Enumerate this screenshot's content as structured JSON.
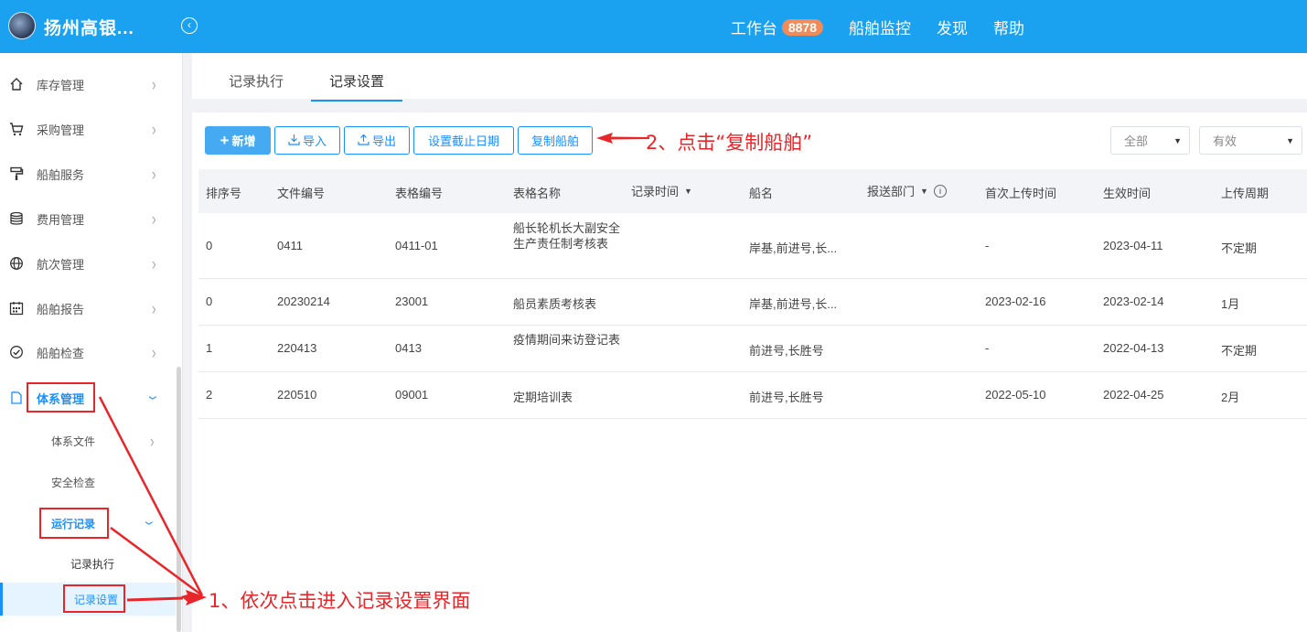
{
  "header": {
    "app_title": "扬州高银...",
    "nav": [
      {
        "label": "工作台",
        "badge": "8878"
      },
      {
        "label": "船舶监控"
      },
      {
        "label": "发现"
      },
      {
        "label": "帮助"
      }
    ]
  },
  "sidebar": {
    "items": [
      {
        "label": "库存管理",
        "icon": "home-icon"
      },
      {
        "label": "采购管理",
        "icon": "cart-icon"
      },
      {
        "label": "船舶服务",
        "icon": "paint-roller-icon"
      },
      {
        "label": "费用管理",
        "icon": "database-icon"
      },
      {
        "label": "航次管理",
        "icon": "globe-icon"
      },
      {
        "label": "船舶报告",
        "icon": "calendar-icon"
      },
      {
        "label": "船舶检查",
        "icon": "check-circle-icon"
      },
      {
        "label": "体系管理",
        "icon": "file-icon"
      }
    ],
    "sub_items": {
      "system_files": "体系文件",
      "safety_check": "安全检查",
      "operation_records": "运行记录",
      "record_execution": "记录执行",
      "record_settings": "记录设置"
    }
  },
  "tabs": [
    "记录执行",
    "记录设置"
  ],
  "toolbar": {
    "add": "新增",
    "import": "导入",
    "export": "导出",
    "set_deadline": "设置截止日期",
    "copy_ship": "复制船舶",
    "filter_all": "全部",
    "filter_status": "有效"
  },
  "annotations": {
    "step2": "2、点击“复制船舶”",
    "step1": "1、依次点击进入记录设置界面"
  },
  "table": {
    "columns": [
      "排序号",
      "文件编号",
      "表格编号",
      "表格名称",
      "记录时间",
      "船名",
      "报送部门",
      "首次上传时间",
      "生效时间",
      "上传周期"
    ],
    "rows": [
      [
        "0",
        "0411",
        "0411-01",
        "船长轮机长大副安全生产责任制考核表",
        "",
        "岸基,前进号,长...",
        "",
        "-",
        "2023-04-11",
        "不定期"
      ],
      [
        "0",
        "20230214",
        "23001",
        "船员素质考核表",
        "",
        "岸基,前进号,长...",
        "",
        "2023-02-16",
        "2023-02-14",
        "1月"
      ],
      [
        "1",
        "220413",
        "0413",
        "疫情期间来访登记表",
        "",
        "前进号,长胜号",
        "",
        "-",
        "2022-04-13",
        "不定期"
      ],
      [
        "2",
        "220510",
        "09001",
        "定期培训表",
        "",
        "前进号,长胜号",
        "",
        "2022-05-10",
        "2022-04-25",
        "2月"
      ]
    ]
  },
  "colors": {
    "header_bg": "#1aa1f0",
    "accent": "#1890ff",
    "annotation_red": "#e8262a",
    "badge_bg": "#f28b5a"
  }
}
